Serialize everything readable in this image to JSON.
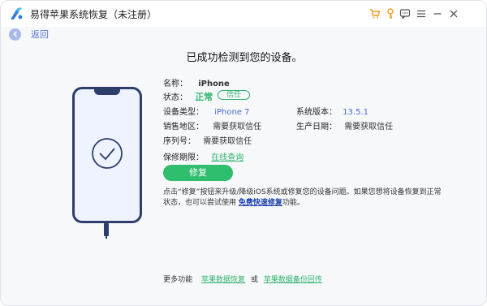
{
  "app": {
    "title": "易得苹果系统恢复（未注册）"
  },
  "titlebar_icons": [
    "cart-icon",
    "key-icon",
    "feedback-icon",
    "menu-icon",
    "minimize-icon",
    "close-icon"
  ],
  "nav": {
    "back_label": "返回"
  },
  "headline": "已成功检测到您的设备。",
  "device": {
    "name_label": "名称：",
    "name_value": "iPhone",
    "status_label": "状态：",
    "status_value": "正常",
    "trust_badge": "信任",
    "type_label": "设备类型：",
    "type_value": "iPhone 7",
    "version_label": "系统版本：",
    "version_value": "13.5.1",
    "region_label": "销售地区：",
    "region_value": "需要获取信任",
    "date_label": "生产日期：",
    "date_value": "需要获取信任",
    "serial_label": "序列号：",
    "serial_value": "需要获取信任",
    "warranty_label": "保修期限：",
    "warranty_link": "在线查询"
  },
  "actions": {
    "repair_label": "修复"
  },
  "description": {
    "part1": "点击“修复”按钮来升级/降级iOS系统或修复您的设备问题。如果您想将设备恢复到正常状态，也可以尝试使用 ",
    "link": "免费快速修复",
    "part2": "功能。"
  },
  "footer": {
    "prefix": "更多功能",
    "link1": "苹果数据恢复",
    "or": "或",
    "link2": "苹果数据备份回传"
  },
  "colors": {
    "accent_green": "#2fbd6e",
    "accent_blue": "#4a6fd6",
    "phone_outline": "#2d3e6b"
  }
}
